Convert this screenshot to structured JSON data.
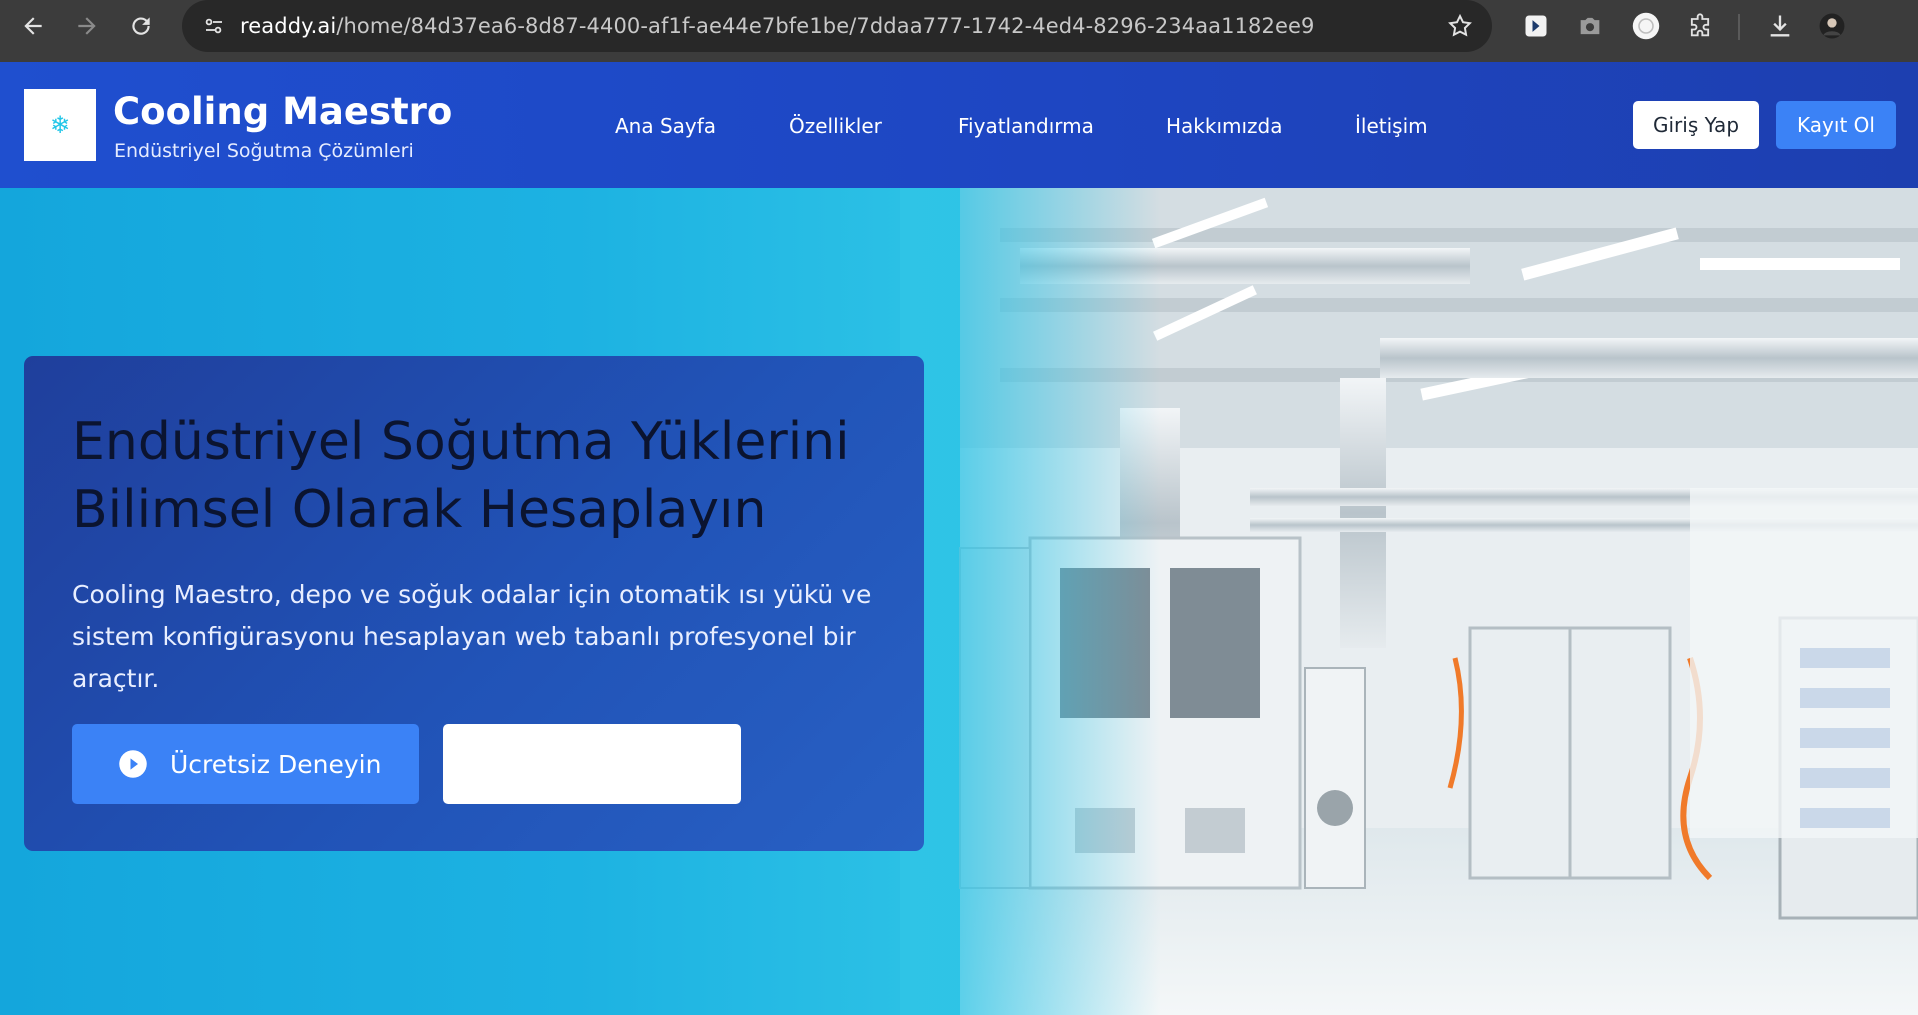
{
  "browser": {
    "url_host": "readdy.ai",
    "url_path": "/home/84d37ea6-8d87-4400-af1f-ae44e7bfe1be/7ddaa777-1742-4ed4-8296-234aa1182ee9",
    "icons": [
      "back-icon",
      "forward-icon",
      "reload-icon",
      "site-settings-icon",
      "bookmark-star-icon",
      "extension-icon",
      "camera-icon",
      "profile-circle-icon",
      "puzzle-icon",
      "download-icon",
      "avatar-icon"
    ]
  },
  "header": {
    "brand_name": "Cooling Maestro",
    "brand_subtitle": "Endüstriyel Soğutma Çözümleri",
    "logo_icon": "snowflake-icon",
    "nav": [
      "Ana Sayfa",
      "Özellikler",
      "Fiyatlandırma",
      "Hakkımızda",
      "İletişim"
    ],
    "login_label": "Giriş Yap",
    "signup_label": "Kayıt Ol",
    "colors": {
      "header_bg": "#1f4fcf",
      "signup_bg": "#3b82f6"
    }
  },
  "hero": {
    "title_line1": "Endüstriyel Soğutma Yüklerini",
    "title_line2": "Bilimsel Olarak Hesaplayın",
    "description": "Cooling Maestro, depo ve soğuk odalar için otomatik ısı yükü ve sistem konfigürasyonu hesaplayan web tabanlı profesyonel bir araçtır.",
    "cta_primary_label": "Ücretsiz Deneyin",
    "cta_primary_icon": "play-circle-icon",
    "cta_secondary_label": "",
    "colors": {
      "card_bg": "#2153b7",
      "primary_btn": "#3b82f6",
      "hero_gradient_start": "#14a6dc"
    }
  }
}
